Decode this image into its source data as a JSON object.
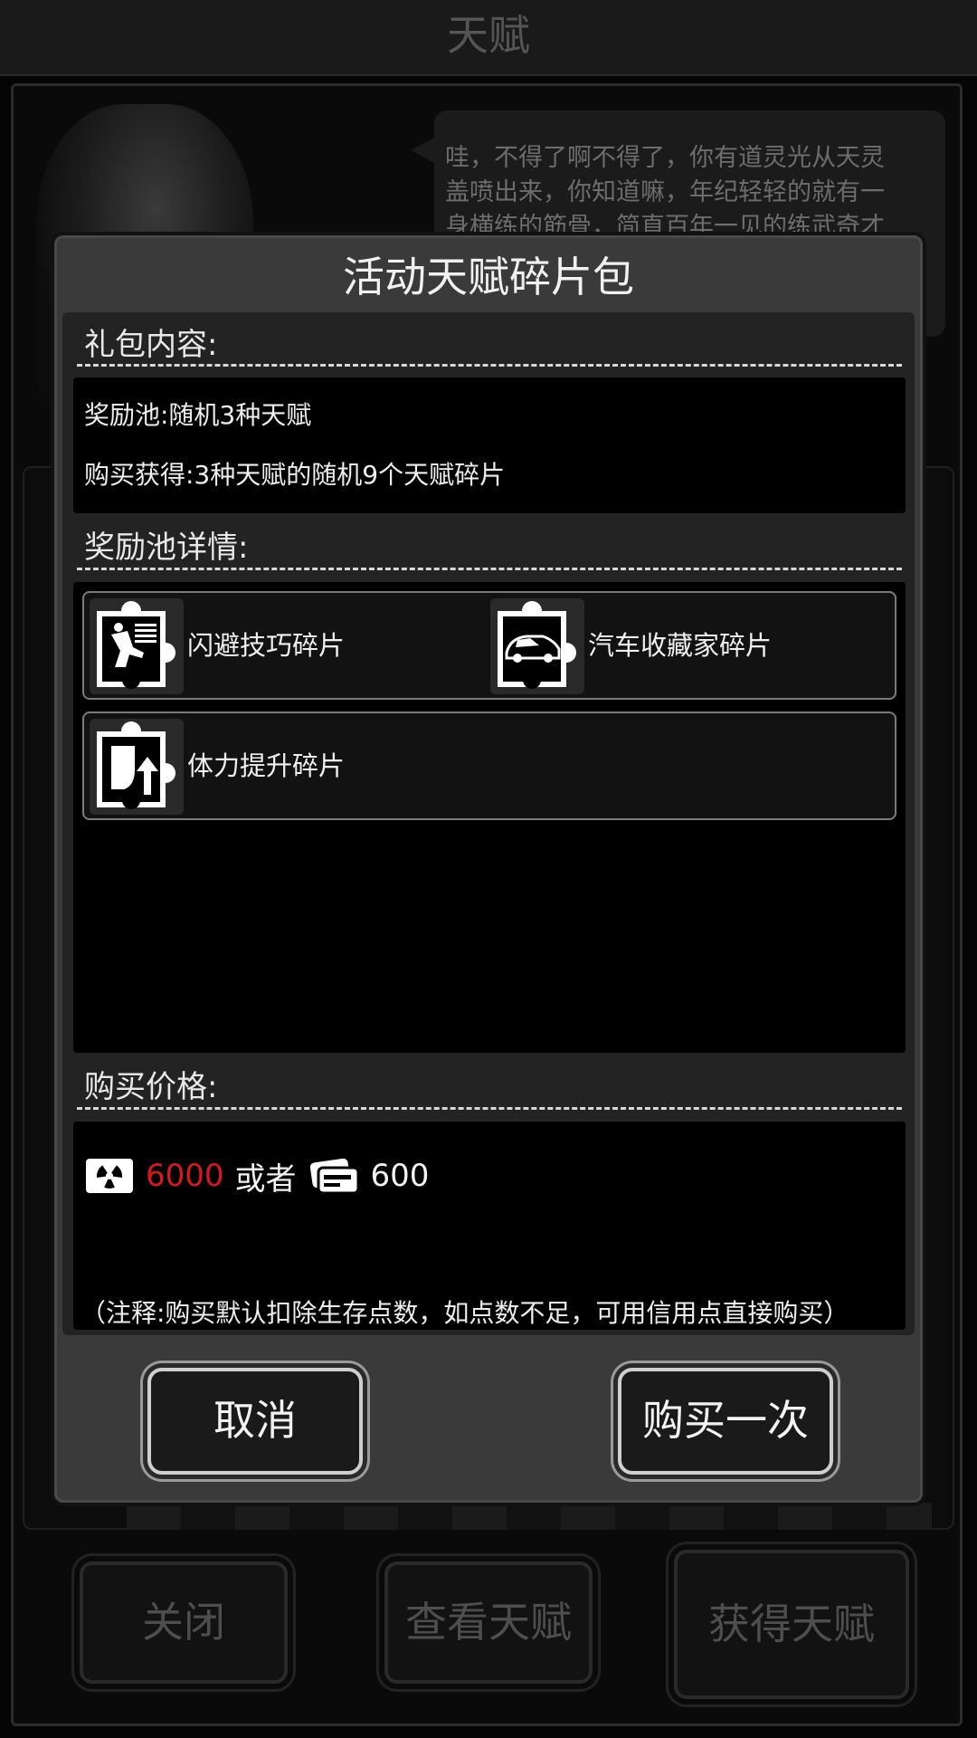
{
  "background": {
    "title": "天赋",
    "speech_lines": [
      "哇，不得了啊不得了，你有道灵光从天灵",
      "盖喷出来，你知道嘛，年纪轻轻的就有一",
      "身横练的筋骨，简直百年一见的练武奇才"
    ],
    "buttons": {
      "close": "关闭",
      "view": "查看天赋",
      "get": "获得天赋"
    }
  },
  "modal": {
    "title": "活动天赋碎片包",
    "contents_label": "礼包内容:",
    "contents": {
      "line1": "奖励池:随机3种天赋",
      "line2": "购买获得:3种天赋的随机9个天赋碎片"
    },
    "pool_label": "奖励池详情:",
    "rewards": [
      {
        "name": "闪避技巧碎片",
        "icon": "dodge-puzzle-icon"
      },
      {
        "name": "汽车收藏家碎片",
        "icon": "car-puzzle-icon"
      },
      {
        "name": "体力提升碎片",
        "icon": "stamina-puzzle-icon"
      }
    ],
    "price_label": "购买价格:",
    "price": {
      "survival_points": "6000",
      "or": "或者",
      "credits": "600"
    },
    "note": "（注释:购买默认扣除生存点数，如点数不足，可用信用点直接购买）",
    "cancel": "取消",
    "buy_once": "购买一次"
  },
  "colors": {
    "price_red": "#d7191c"
  }
}
